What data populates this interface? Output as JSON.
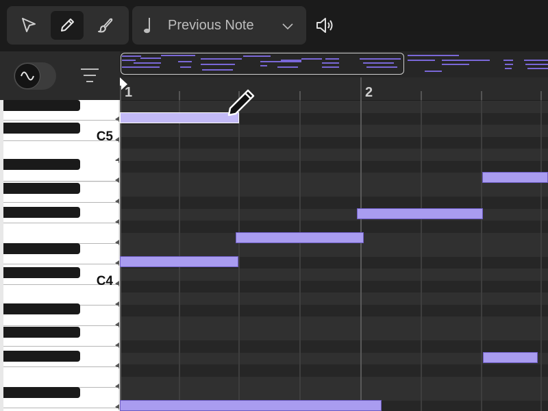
{
  "toolbar": {
    "tools": [
      {
        "name": "pointer-tool",
        "icon": "pointer-icon",
        "active": false
      },
      {
        "name": "pencil-tool",
        "icon": "pencil-icon",
        "active": true
      },
      {
        "name": "brush-tool",
        "icon": "brush-icon",
        "active": false
      }
    ],
    "note_length": {
      "label": "Previous Note",
      "icon": "quarter-note-icon",
      "chevron": "chevron-down-icon"
    },
    "audition": {
      "icon": "speaker-icon"
    }
  },
  "sidebar": {
    "waveform_toggle": {
      "icon": "sine-wave-icon",
      "on": true
    },
    "menu_icon": "filter-menu-icon"
  },
  "ruler": {
    "bars": [
      "1",
      "2"
    ]
  },
  "keyboard": {
    "labels": [
      "C5",
      "C4"
    ]
  },
  "colors": {
    "note": "#a99cf0",
    "note_selected": "#c3baf6",
    "accent": "#7a68d8"
  }
}
